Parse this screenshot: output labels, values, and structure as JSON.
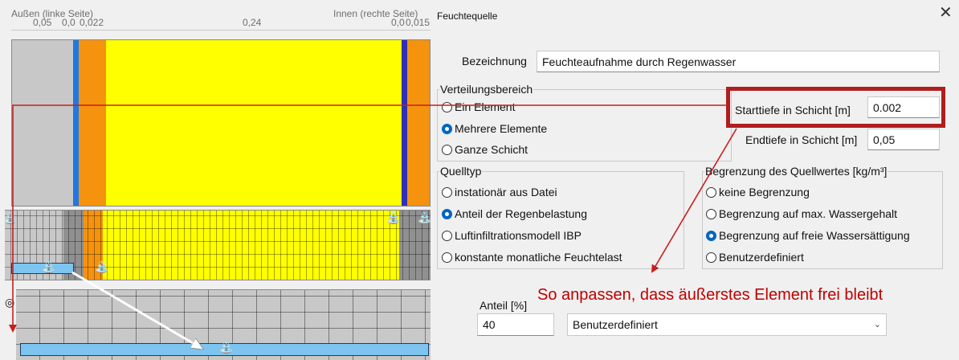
{
  "left_panel": {
    "header_left": "Außen (linke Seite)",
    "header_right": "Innen (rechte Seite)",
    "thickness_labels": [
      "0,05",
      "0,0",
      "0,022",
      "0,24",
      "0,0",
      "0,015"
    ],
    "colors": {
      "grey_layer": "#c8c8c8",
      "blue_strip": "#1e78e6",
      "orange_layer": "#f5930f",
      "yellow_layer": "#ffff00",
      "navy_strip": "#3030b8",
      "source_bar": "#7ec4f0"
    }
  },
  "dialog": {
    "title": "Feuchtequelle",
    "close_icon": "close-icon",
    "designation_label": "Bezeichnung",
    "designation_value": "Feuchteaufnahme durch Regenwasser",
    "distribution": {
      "legend": "Verteilungsbereich",
      "options": [
        "Ein Element",
        "Mehrere Elemente",
        "Ganze Schicht"
      ],
      "selected": "Mehrere Elemente",
      "start_label": "Starttiefe in Schicht [m]",
      "start_value": "0.002",
      "end_label": "Endtiefe in Schicht [m]",
      "end_value": "0,05"
    },
    "source_type": {
      "legend": "Quelltyp",
      "options": [
        "instationär aus Datei",
        "Anteil der Regenbelastung",
        "Luftinfiltrationsmodell IBP",
        "konstante monatliche Feuchtelast"
      ],
      "selected": "Anteil der Regenbelastung"
    },
    "limit": {
      "legend": "Begrenzung des Quellwertes [kg/m³]",
      "options": [
        "keine Begrenzung",
        "Begrenzung auf max. Wassergehalt",
        "Begrenzung auf freie Wassersättigung",
        "Benutzerdefiniert"
      ],
      "selected": "Begrenzung auf freie Wassersättigung"
    },
    "share_label": "Anteil [%]",
    "share_value": "40",
    "dropdown_value": "Benutzerdefiniert",
    "annotation": "So anpassen, dass äußerstes Element frei bleibt",
    "annotation_color": "#c00000"
  }
}
